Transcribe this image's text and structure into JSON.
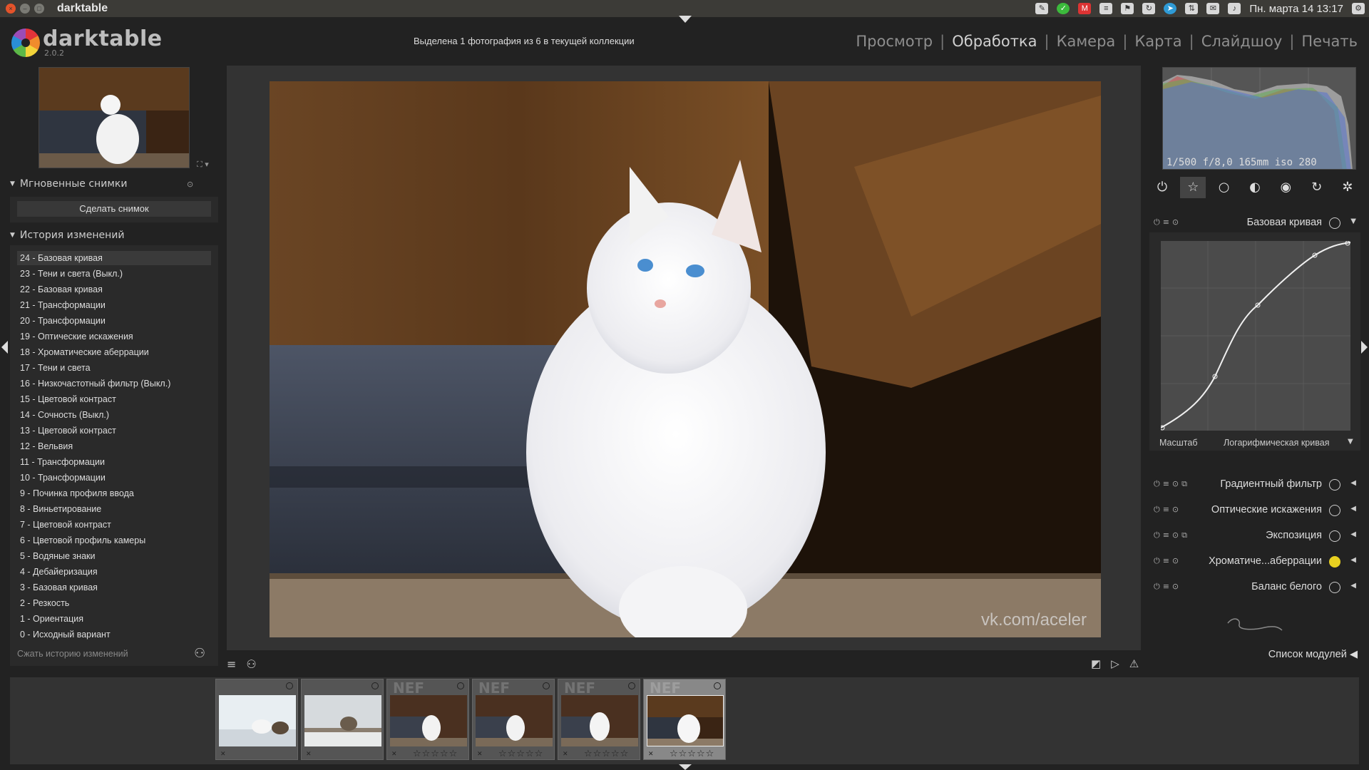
{
  "system": {
    "app_title": "darktable",
    "clock": "Пн. марта 14 13:17"
  },
  "header": {
    "logo_text": "darktable",
    "version": "2.0.2",
    "collection_info": "Выделена 1 фотография из 6 в текущей коллекции",
    "views": [
      "Просмотр",
      "Обработка",
      "Камера",
      "Карта",
      "Слайдшоу",
      "Печать"
    ],
    "active_view": "Обработка",
    "separator": "|"
  },
  "left": {
    "snapshots_title": "Мгновенные снимки",
    "snapshot_button": "Сделать снимок",
    "history_title": "История изменений",
    "history": [
      "24 - Базовая кривая",
      "23 - Тени и света (Выкл.)",
      "22 - Базовая кривая",
      "21 - Трансформации",
      "20 - Трансформации",
      "19 - Оптические искажения",
      "18 - Хроматические аберрации",
      "17 - Тени и света",
      "16 - Низкочастотный фильтр (Выкл.)",
      "15 - Цветовой контраст",
      "14 - Сочность (Выкл.)",
      "13 - Цветовой контраст",
      "12 - Вельвия",
      "11 - Трансформации",
      "10 - Трансформации",
      "9 - Починка профиля ввода",
      "8 - Виньетирование",
      "7 - Цветовой контраст",
      "6 - Цветовой профиль камеры",
      "5 - Водяные знаки",
      "4 - Дебайеризация",
      "3 - Базовая кривая",
      "2 - Резкость",
      "1 - Ориентация",
      "0 - Исходный вариант"
    ],
    "compress_label": "Сжать историю изменений"
  },
  "center": {
    "watermark": "vk.com/aceler"
  },
  "right": {
    "exif": "1/500 f/8,0 165mm iso 280",
    "base_curve": {
      "title": "Базовая кривая",
      "scale_label": "Масштаб",
      "scale_value": "Логарифмическая кривая"
    },
    "modules": [
      "Градиентный фильтр",
      "Оптические искажения",
      "Экспозиция",
      "Хроматиче...аберрации",
      "Баланс белого"
    ],
    "modules_list_label": "Список модулей"
  },
  "filmstrip": {
    "count": 6,
    "selected_index": 5,
    "rated_from_index": 2,
    "nef_label": "NEF",
    "stars": "☆☆☆☆☆"
  },
  "colors": {
    "accent": "#d0d0d0",
    "background": "#222222",
    "panel": "#2a2a2a"
  }
}
